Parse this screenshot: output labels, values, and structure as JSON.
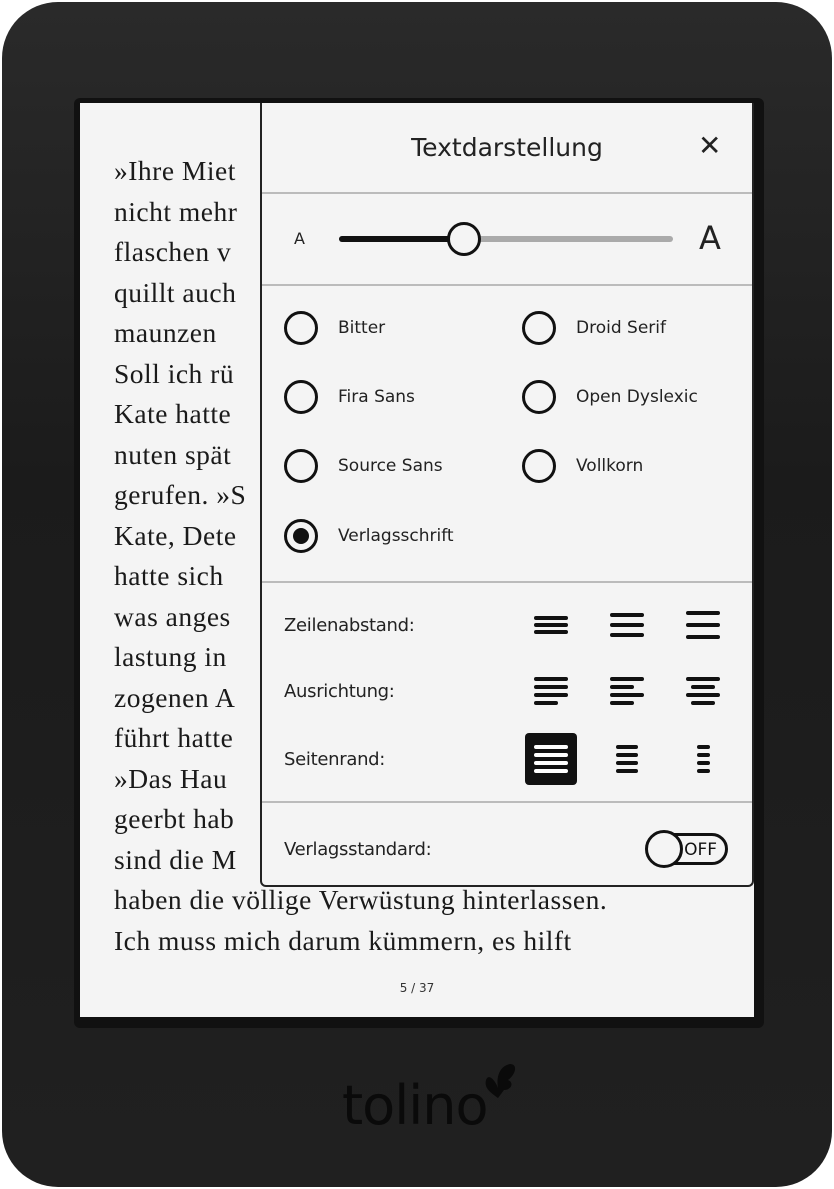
{
  "book": {
    "lines": [
      "»Ihre Miet",
      "nicht mehr",
      "flaschen v",
      "quillt auch",
      "maunzen",
      "Soll ich rü",
      "Kate hatte",
      "nuten spät",
      "gerufen. »S",
      "Kate, Dete",
      "hatte sich",
      "was anges",
      "lastung in",
      "zogenen A",
      "führt hatte",
      "»Das Hau",
      "geerbt hab",
      "sind die M",
      "haben die völlige Verwüstung hinterlassen.",
      "Ich muss mich darum kümmern, es hilft"
    ],
    "page": "5 / 37"
  },
  "popup": {
    "title": "Textdarstellung",
    "close_icon": "close-icon",
    "font_size": {
      "small_label": "A",
      "large_label": "A",
      "level": 0.375
    },
    "fonts": [
      {
        "label": "Bitter",
        "selected": false
      },
      {
        "label": "Droid Serif",
        "selected": false
      },
      {
        "label": "Fira Sans",
        "selected": false
      },
      {
        "label": "Open Dyslexic",
        "selected": false
      },
      {
        "label": "Source Sans",
        "selected": false
      },
      {
        "label": "Vollkorn",
        "selected": false
      },
      {
        "label": "Verlagsschrift",
        "selected": true
      }
    ],
    "line_spacing_label": "Zeilenabstand:",
    "alignment_label": "Ausrichtung:",
    "margin_label": "Seitenrand:",
    "selected_margin": "wide",
    "publisher_default_label": "Verlagsstandard:",
    "publisher_default_state": "OFF"
  },
  "device": {
    "logo": "tolino"
  }
}
